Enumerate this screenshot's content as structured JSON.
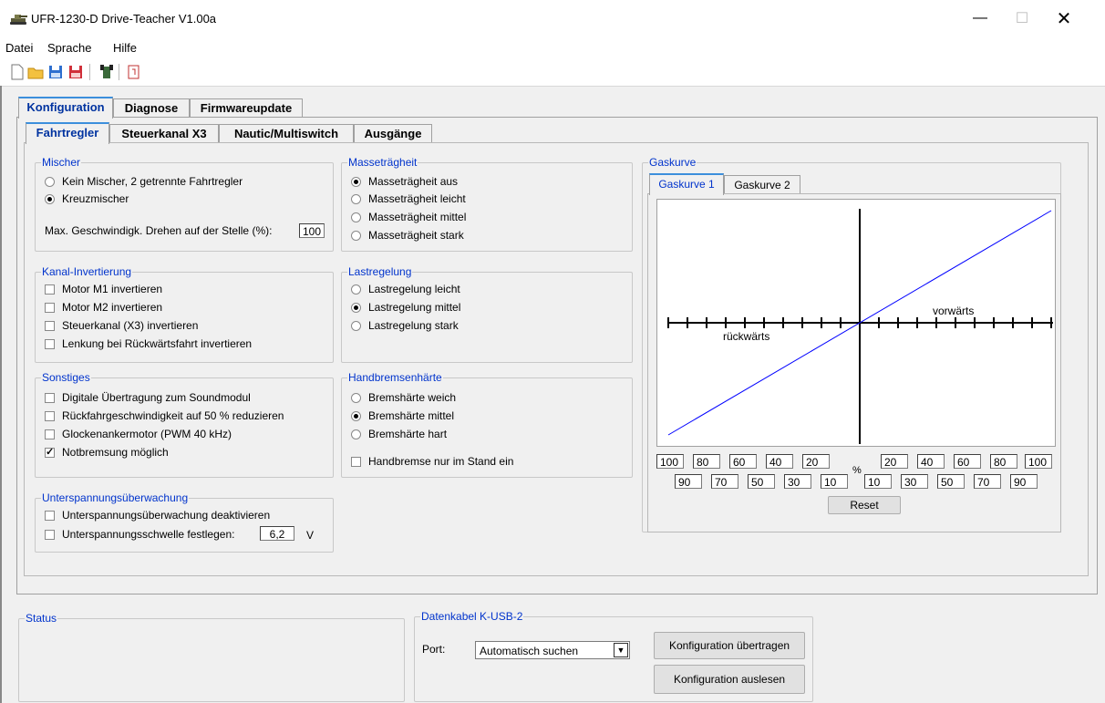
{
  "window": {
    "title": "UFR-1230-D Drive-Teacher V1.00a"
  },
  "menu": [
    "Datei",
    "Sprache",
    "Hilfe"
  ],
  "main_tabs": [
    "Konfiguration",
    "Diagnose",
    "Firmwareupdate"
  ],
  "sub_tabs": [
    "Fahrtregler",
    "Steuerkanal X3",
    "Nautic/Multiswitch",
    "Ausgänge"
  ],
  "mischer": {
    "legend": "Mischer",
    "options": [
      "Kein Mischer, 2 getrennte Fahrtregler",
      "Kreuzmischer"
    ],
    "selected": 1,
    "max_label": "Max. Geschwindigk. Drehen auf der Stelle (%):",
    "max_value": "100"
  },
  "kanal": {
    "legend": "Kanal-Invertierung",
    "items": [
      "Motor M1 invertieren",
      "Motor M2 invertieren",
      "Steuerkanal (X3) invertieren",
      "Lenkung bei Rückwärtsfahrt invertieren"
    ]
  },
  "sonstiges": {
    "legend": "Sonstiges",
    "items": [
      "Digitale Übertragung zum Soundmodul",
      "Rückfahrgeschwindigkeit auf 50 % reduzieren",
      "Glockenankermotor (PWM 40 kHz)",
      "Notbremsung möglich"
    ],
    "checked": [
      false,
      false,
      false,
      true
    ]
  },
  "unterspannung": {
    "legend": "Unterspannungsüberwachung",
    "deactivate": "Unterspannungsüberwachung deaktivieren",
    "threshold_label": "Unterspannungsschwelle festlegen:",
    "threshold_value": "6,2",
    "unit": "V"
  },
  "masse": {
    "legend": "Masseträgheit",
    "options": [
      "Masseträgheit aus",
      "Masseträgheit leicht",
      "Masseträgheit mittel",
      "Masseträgheit stark"
    ],
    "selected": 0
  },
  "last": {
    "legend": "Lastregelung",
    "options": [
      "Lastregelung leicht",
      "Lastregelung mittel",
      "Lastregelung stark"
    ],
    "selected": 1
  },
  "hand": {
    "legend": "Handbremsenhärte",
    "options": [
      "Bremshärte weich",
      "Bremshärte mittel",
      "Bremshärte hart"
    ],
    "selected": 1,
    "standstill": "Handbremse nur im Stand ein"
  },
  "gaskurve": {
    "legend": "Gaskurve",
    "tabs": [
      "Gaskurve 1",
      "Gaskurve 2"
    ],
    "label_forward": "vorwärts",
    "label_backward": "rückwärts",
    "row1_left": [
      "100",
      "80",
      "60",
      "40",
      "20"
    ],
    "percent": "%",
    "row1_right": [
      "20",
      "40",
      "60",
      "80",
      "100"
    ],
    "row2_left": [
      "90",
      "70",
      "50",
      "30",
      "10"
    ],
    "row2_right": [
      "10",
      "30",
      "50",
      "70",
      "90"
    ],
    "reset": "Reset",
    "colors": {
      "line": "#0000ff"
    }
  },
  "status": {
    "legend": "Status"
  },
  "datenkabel": {
    "legend": "Datenkabel K-USB-2",
    "port_label": "Port:",
    "port_value": "Automatisch suchen",
    "send_button": "Konfiguration übertragen",
    "read_button": "Konfiguration auslesen"
  }
}
